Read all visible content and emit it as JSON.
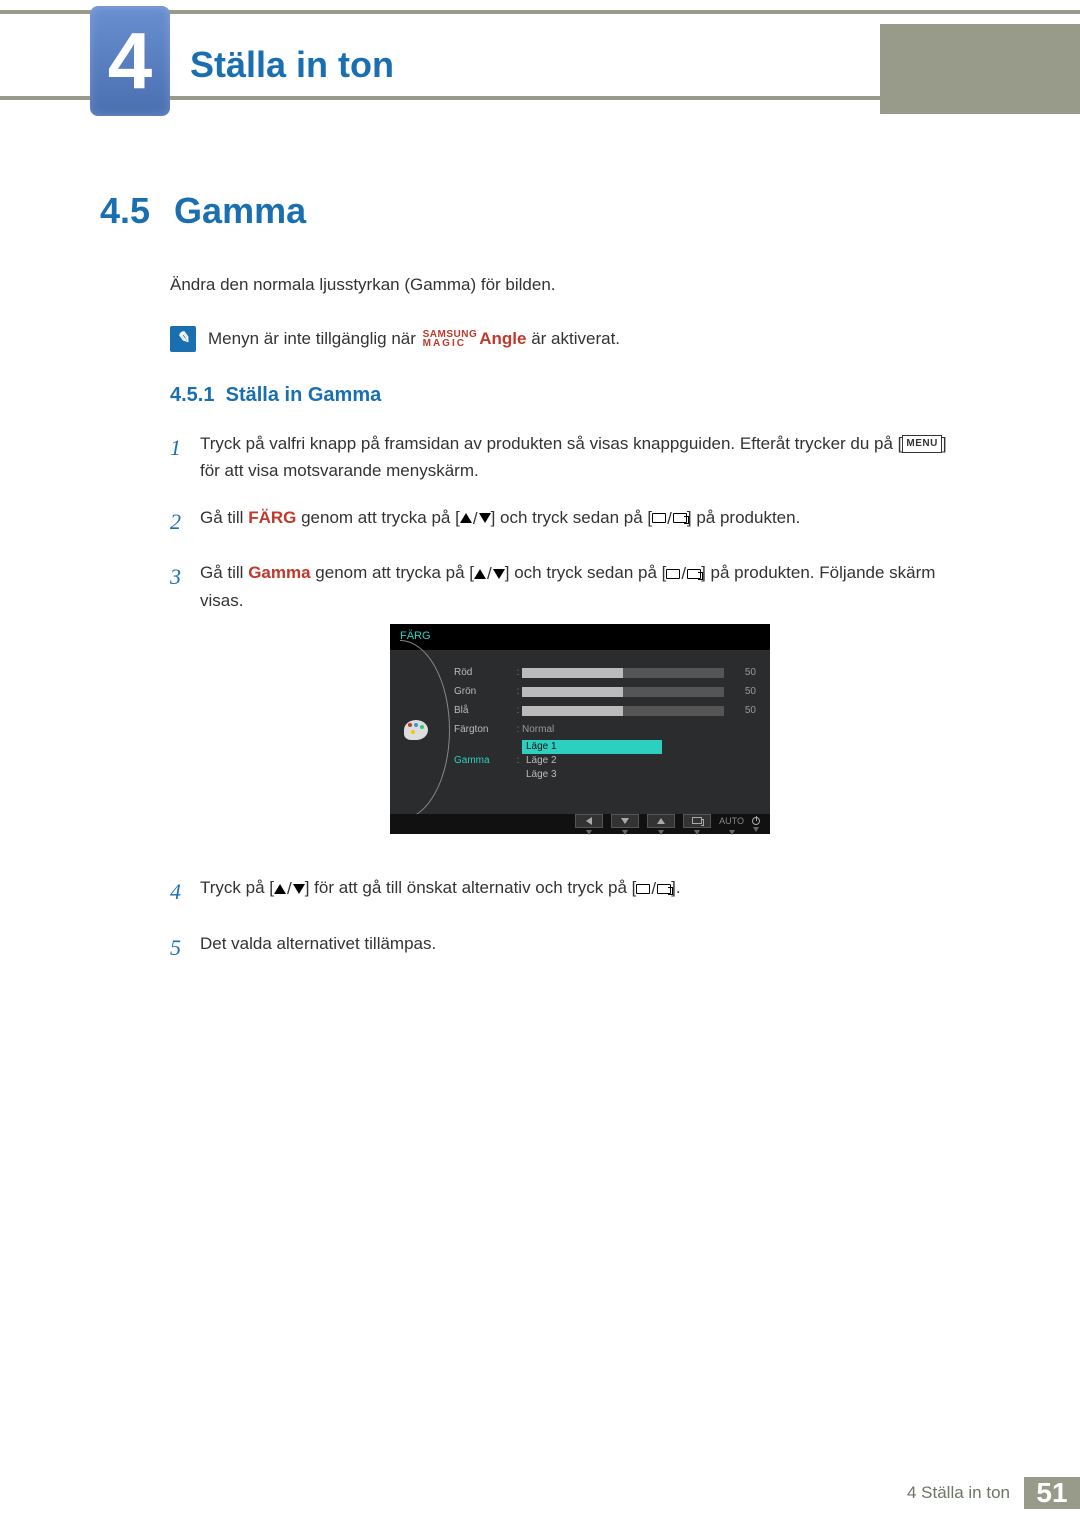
{
  "header": {
    "chapter_number": "4",
    "chapter_title": "Ställa in ton"
  },
  "section": {
    "number": "4.5",
    "title": "Gamma",
    "intro": "Ändra den normala ljusstyrkan (Gamma) för bilden.",
    "note_prefix": "Menyn är inte tillgänglig när ",
    "note_brand_top": "SAMSUNG",
    "note_brand_bottom": "MAGIC",
    "note_angle": "Angle",
    "note_suffix": " är aktiverat."
  },
  "subsection": {
    "number": "4.5.1",
    "title": "Ställa in Gamma"
  },
  "steps": {
    "s1a": "Tryck på valfri knapp på framsidan av produkten så visas knappguiden. Efteråt trycker du på [",
    "s1_menu": "MENU",
    "s1b": "] för att visa motsvarande menyskärm.",
    "s2a": "Gå till ",
    "s2_farg": "FÄRG",
    "s2b": " genom att trycka på [",
    "s2c": "] och tryck sedan på [",
    "s2d": "] på produkten.",
    "s3a": "Gå till ",
    "s3_gamma": "Gamma",
    "s3b": " genom att trycka på [",
    "s3c": "] och tryck sedan på [",
    "s3d": "] på produkten. Följande skärm visas.",
    "s4a": "Tryck på [",
    "s4b": "] för att gå till önskat alternativ och tryck på [",
    "s4c": "].",
    "s5": "Det valda alternativet tillämpas."
  },
  "osd": {
    "title": "FÄRG",
    "rows": {
      "red": {
        "label": "Röd",
        "value": "50",
        "pct": 50
      },
      "green": {
        "label": "Grön",
        "value": "50",
        "pct": 50
      },
      "blue": {
        "label": "Blå",
        "value": "50",
        "pct": 50
      },
      "tone": {
        "label": "Färgton",
        "value": "Normal"
      },
      "gamma": {
        "label": "Gamma"
      }
    },
    "options": {
      "o1": "Läge 1",
      "o2": "Läge 2",
      "o3": "Läge 3"
    },
    "nav": {
      "auto": "AUTO"
    }
  },
  "footer": {
    "label": "4 Ställa in ton",
    "page": "51"
  }
}
